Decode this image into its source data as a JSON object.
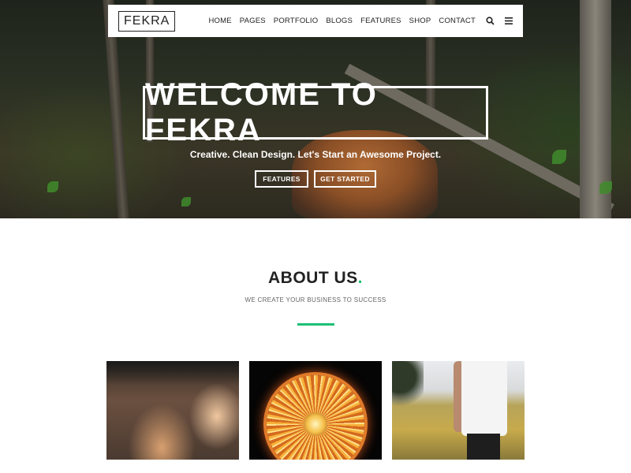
{
  "brand": {
    "logo_text": "FEKRA"
  },
  "nav": {
    "items": [
      "HOME",
      "PAGES",
      "PORTFOLIO",
      "BLOGS",
      "FEATURES",
      "SHOP",
      "CONTACT"
    ],
    "icons": [
      "search-icon",
      "menu-icon"
    ]
  },
  "hero": {
    "title": "WELCOME TO FEKRA",
    "subtitle": "Creative. Clean Design. Let's Start an Awesome Project.",
    "buttons": {
      "features": "FEATURES",
      "get_started": "GET STARTED"
    }
  },
  "about": {
    "title": "ABOUT US",
    "title_dot": ".",
    "subtitle": "WE CREATE YOUR BUSINESS TO SUCCESS",
    "accent_color": "#1fbf76"
  },
  "cards": [
    "crowd-photo",
    "ferris-wheel-photo",
    "field-person-photo"
  ]
}
